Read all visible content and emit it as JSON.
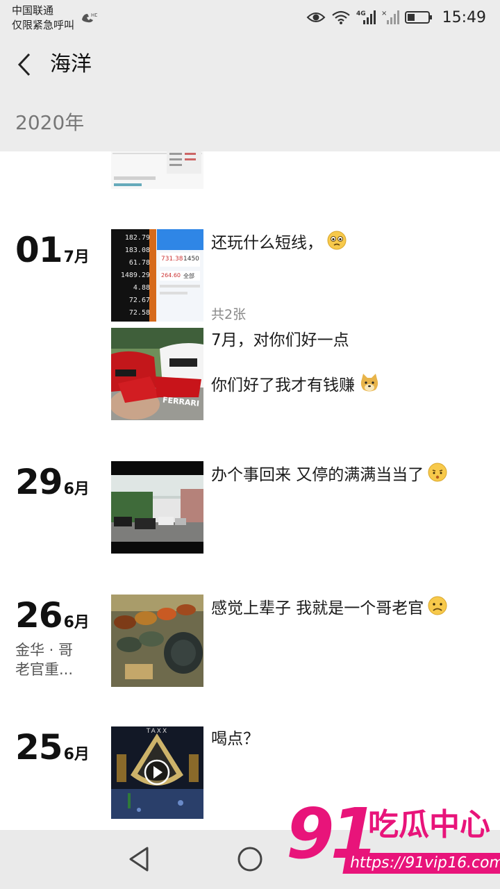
{
  "status_bar": {
    "carrier": "中国联通",
    "carrier_sub": "仅限紧急呼叫",
    "hd_label": "HD",
    "network": "4G",
    "time": "15:49"
  },
  "header": {
    "title": "海洋",
    "year": "2020年"
  },
  "posts": [
    {
      "day": "01",
      "month": "7月",
      "caption": "还玩什么短线，",
      "emoji": "pleading-face-emoji",
      "count": "共2张"
    },
    {
      "caption_line1": "7月，对你们好一点",
      "caption_line2": "你们好了我才有钱赚",
      "emoji": "doge-emoji"
    },
    {
      "day": "29",
      "month": "6月",
      "caption": "办个事回来 又停的满满当当了",
      "emoji": "grimace-face-emoji"
    },
    {
      "day": "26",
      "month": "6月",
      "location_line1": "金华 · 哥",
      "location_line2": "老官重...",
      "caption": "感觉上辈子 我就是一个哥老官",
      "emoji": "sad-face-emoji"
    },
    {
      "day": "25",
      "month": "6月",
      "caption": "喝点？",
      "thumb_label": "TAXX"
    }
  ],
  "thumb_texts": {
    "stock_numbers": [
      "182.79",
      "183.08",
      "61.78",
      "1489.29",
      "4.88",
      "72.67",
      "72.58"
    ],
    "stock_right": [
      "731.38",
      "1450",
      "264.60",
      "全部"
    ],
    "car_plate": "FERRARI"
  },
  "watermark": {
    "number": "91",
    "text": "吃瓜中心",
    "url": "https://91vip16.com"
  },
  "colors": {
    "header_bg": "#ececec",
    "watermark": "#e8147a",
    "nav_bg": "#eaeaea"
  }
}
